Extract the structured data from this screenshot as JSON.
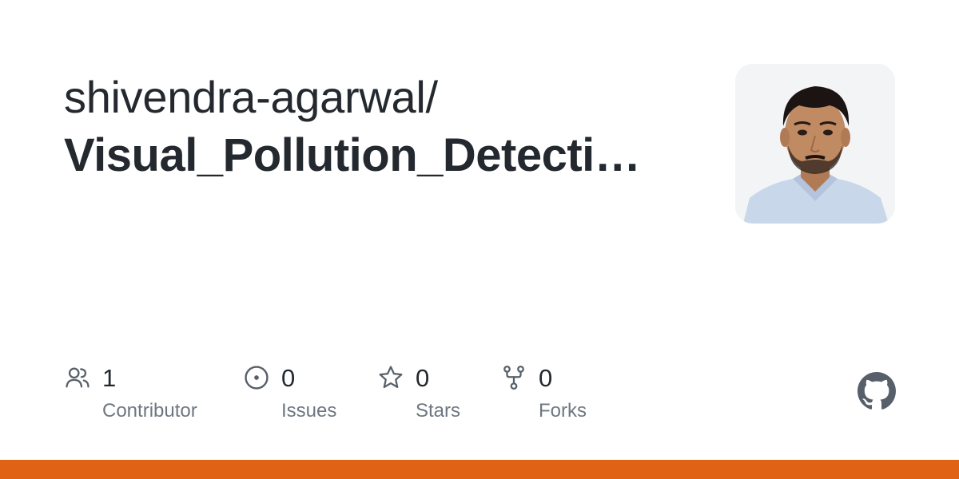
{
  "repo": {
    "owner": "shivendra-agarwal/",
    "name": "Visual_Pollution_Detecti…"
  },
  "stats": {
    "contributors": {
      "count": "1",
      "label": "Contributor",
      "icon": "people-icon"
    },
    "issues": {
      "count": "0",
      "label": "Issues",
      "icon": "issue-opened-icon"
    },
    "stars": {
      "count": "0",
      "label": "Stars",
      "icon": "star-icon"
    },
    "forks": {
      "count": "0",
      "label": "Forks",
      "icon": "repo-forked-icon"
    }
  },
  "colors": {
    "text": "#24292f",
    "muted": "#6e7781",
    "accent_bar": "#e06315"
  },
  "avatar": {
    "description_icon": "user-avatar"
  },
  "logo": {
    "icon": "github-mark-icon"
  }
}
